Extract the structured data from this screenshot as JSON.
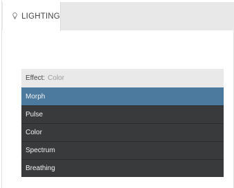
{
  "tab": {
    "icon": "lightbulb-icon",
    "label": "LIGHTING"
  },
  "effect_select": {
    "key_label": "Effect:",
    "current_value": "Color",
    "options": [
      {
        "label": "Morph",
        "selected": true
      },
      {
        "label": "Pulse",
        "selected": false
      },
      {
        "label": "Color",
        "selected": false
      },
      {
        "label": "Spectrum",
        "selected": false
      },
      {
        "label": "Breathing",
        "selected": false
      }
    ]
  },
  "colors": {
    "selected_option": "#4b7a9e",
    "option_bg": "#393a3c",
    "select_head_bg": "#e9e9e9",
    "header_strip": "#e8e8e8"
  }
}
